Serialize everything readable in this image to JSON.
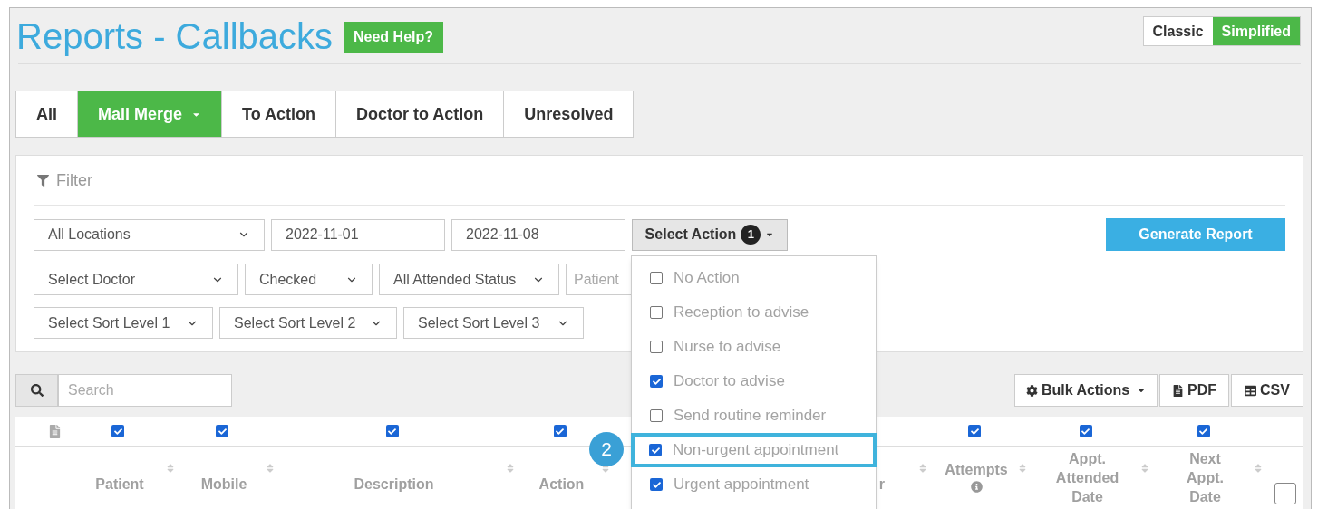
{
  "header": {
    "title": "Reports - Callbacks",
    "help_button": "Need Help?"
  },
  "view_toggle": [
    {
      "label": "Classic",
      "selected": false
    },
    {
      "label": "Simplified",
      "selected": true
    }
  ],
  "tabs": [
    {
      "label": "All",
      "selected": false,
      "dropdown": false
    },
    {
      "label": "Mail Merge",
      "selected": true,
      "dropdown": true
    },
    {
      "label": "To Action",
      "selected": false,
      "dropdown": false
    },
    {
      "label": "Doctor to Action",
      "selected": false,
      "dropdown": false
    },
    {
      "label": "Unresolved",
      "selected": false,
      "dropdown": false
    }
  ],
  "filter": {
    "title": "Filter",
    "rows": [
      [
        {
          "kind": "select",
          "value": "All Locations"
        },
        {
          "kind": "input",
          "value": "2022-11-01"
        },
        {
          "kind": "input",
          "value": "2022-11-08"
        },
        {
          "kind": "menu_button",
          "value": "Select Action",
          "badge": "1"
        }
      ],
      [
        {
          "kind": "select",
          "value": "Select Doctor"
        },
        {
          "kind": "select",
          "value": "Checked"
        },
        {
          "kind": "select",
          "value": "All Attended Status"
        },
        {
          "kind": "placeholder",
          "placeholder": "Patient"
        }
      ],
      [
        {
          "kind": "select",
          "value": "Select Sort Level 1"
        },
        {
          "kind": "select",
          "value": "Select Sort Level 2"
        },
        {
          "kind": "select",
          "value": "Select Sort Level 3"
        }
      ]
    ],
    "generate_button": "Generate Report"
  },
  "action_menu": {
    "callout": "2",
    "items": [
      {
        "label": "No Action",
        "checked": false,
        "highlighted": false
      },
      {
        "label": "Reception to advise",
        "checked": false,
        "highlighted": false
      },
      {
        "label": "Nurse to advise",
        "checked": false,
        "highlighted": false
      },
      {
        "label": "Doctor to advise",
        "checked": true,
        "highlighted": false
      },
      {
        "label": "Send routine reminder",
        "checked": false,
        "highlighted": false
      },
      {
        "label": "Non-urgent appointment",
        "checked": true,
        "highlighted": true
      },
      {
        "label": "Urgent appointment",
        "checked": true,
        "highlighted": false
      }
    ]
  },
  "table": {
    "search": {
      "placeholder": "Search"
    },
    "buttons": [
      {
        "kind": "bulk",
        "label": "Bulk Actions"
      },
      {
        "kind": "pdf",
        "label": "PDF"
      },
      {
        "kind": "csv",
        "label": "CSV"
      }
    ],
    "columns": [
      {
        "header": "Patient",
        "checked": true
      },
      {
        "header": "Mobile",
        "checked": true
      },
      {
        "header": "Description",
        "checked": true
      },
      {
        "header": "Action",
        "checked": true
      },
      {
        "header": "r"
      },
      {
        "header": "Attempts",
        "checked": true,
        "info": true
      },
      {
        "header": "Appt. Attended Date",
        "checked": true
      },
      {
        "header": "Next Appt. Date",
        "checked": true
      }
    ],
    "select_all": {
      "checked": false
    }
  }
}
